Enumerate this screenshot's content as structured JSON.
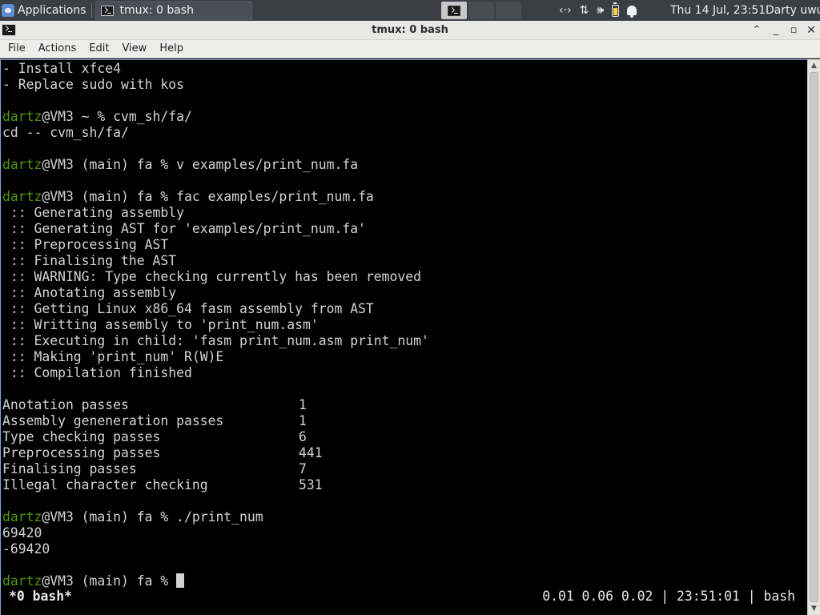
{
  "panel": {
    "applications_label": "Applications",
    "task_title": "tmux: 0 bash",
    "clock": "Thu 14 Jul, 23:51",
    "user": "Darty uwu",
    "tray_icons": [
      "network-arrows-icon",
      "transfer-icon",
      "volume-icon",
      "battery-icon",
      "bell-icon"
    ],
    "colors": {
      "panel_bg": "#3b3e45",
      "battery_fill": "#ffd23f"
    }
  },
  "window": {
    "title": "tmux: 0 bash",
    "menu": [
      "File",
      "Actions",
      "Edit",
      "View",
      "Help"
    ]
  },
  "terminal": {
    "colors": {
      "prompt_user": "#4e9a06",
      "text": "#d3d3d3",
      "background": "#000000"
    },
    "prompt_suffix": "@VM3 (main) fa % ",
    "lines": [
      "- Install xfce4",
      "- Replace sudo with kos",
      "",
      "",
      "cd -- cvm_sh/fa/",
      "",
      "",
      "",
      "",
      " :: Generating assembly",
      " :: Generating AST for 'examples/print_num.fa'",
      " :: Preprocessing AST",
      " :: Finalising the AST",
      " :: WARNING: Type checking currently has been removed",
      " :: Anotating assembly",
      " :: Getting Linux x86_64 fasm assembly from AST",
      " :: Writting assembly to 'print_num.asm'",
      " :: Executing in child: 'fasm print_num.asm print_num'",
      " :: Making 'print_num' R(W)E",
      " :: Compilation finished",
      ""
    ],
    "prompt_lines": [
      {
        "user": "dartz",
        "rest": "@VM3 ~ % cvm_sh/fa/"
      },
      {
        "user": "dartz",
        "rest": "@VM3 (main) fa % v examples/print_num.fa"
      },
      {
        "user": "dartz",
        "rest": "@VM3 (main) fa % fac examples/print_num.fa"
      },
      {
        "user": "dartz",
        "rest": "@VM3 (main) fa % ./print_num"
      },
      {
        "user": "dartz",
        "rest": "@VM3 (main) fa % "
      }
    ],
    "stats": [
      {
        "label": "Anotation passes",
        "value": "1"
      },
      {
        "label": "Assembly geneneration passes",
        "value": "1"
      },
      {
        "label": "Type checking passes",
        "value": "6"
      },
      {
        "label": "Preprocessing passes",
        "value": "441"
      },
      {
        "label": "Finalising passes",
        "value": "7"
      },
      {
        "label": "Illegal character checking",
        "value": "531"
      }
    ],
    "output": [
      "69420",
      "-69420"
    ],
    "tmux_status": {
      "window": "*0 bash*",
      "right": "0.01 0.06 0.02 | 23:51:01 | bash"
    }
  }
}
